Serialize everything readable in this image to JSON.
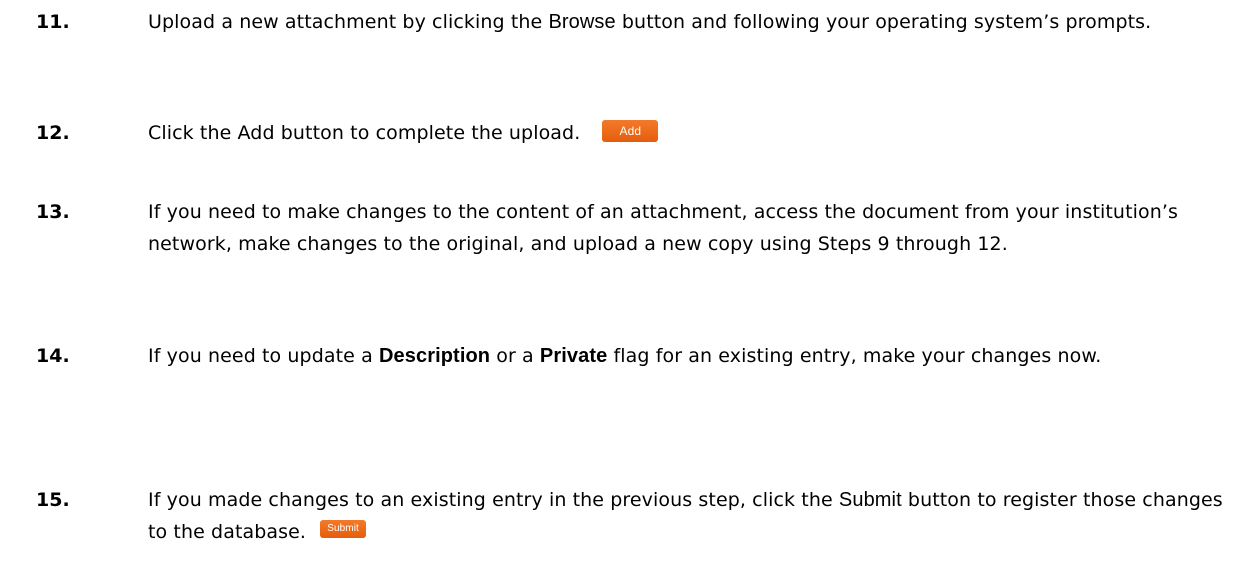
{
  "steps": [
    {
      "number": "11.",
      "text_a": "Upload a new attachment by clicking the ",
      "ui_term": "Browse",
      "text_b": " button and following your operating system’s prompts."
    },
    {
      "number": "12.",
      "text": "Click the Add button to complete the upload.",
      "button_label": "Add"
    },
    {
      "number": "13.",
      "text": "If you need to make changes to the content of an attachment, access the document from your institution’s network, make changes to the original, and upload a new copy using Steps 9 through 12."
    },
    {
      "number": "14.",
      "text_a": "If you need to update a ",
      "term_1": "Description",
      "text_b": " or a ",
      "term_2": "Private",
      "text_c": " flag for an existing entry, make your changes now."
    },
    {
      "number": "15.",
      "text_a": "If you made changes to an existing entry in the previous step, click the ",
      "ui_term": "Submit",
      "text_b": " button to register those changes to the database.",
      "button_label": "Submit"
    }
  ],
  "colors": {
    "button_orange": "#ef6c1c",
    "button_text": "#ffffff",
    "body_text": "#000000"
  }
}
